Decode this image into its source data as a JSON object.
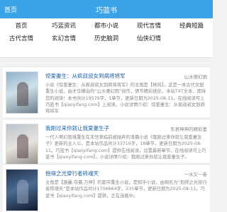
{
  "header": {
    "home_label": "首页",
    "title": "巧蓝书"
  },
  "nav": {
    "row1": [
      "首页",
      "巧蓝资讯",
      "都市小说",
      "现代言情",
      "经典短篇"
    ],
    "row2": [
      "古代言情",
      "玄幻言情",
      "历史脑洞",
      "仙侠幻情"
    ]
  },
  "books": [
    {
      "title": "惊爱妻生：从疯叔叔女到病将将军",
      "author": "山水傻幻雨",
      "desc": "小说《惊爱妻生：从疯叔叔女到病将将军》的主角是【林风】，这是一本古代女配重生小说，由才华横溢的“山水傻幻雨”创作，情节精彩绝伦。本站TXT全本，期待您的阅读！本书共计19579字，1章节，更新日期为2025-08-11。在线阅读可上巧蓝书【qiaoyifang.com】上阅读。小说详情介绍：惊爱妻生：从疯叔叔女到病将将军"
    },
    {
      "title": "我刚过来你就让我爱妻生子",
      "author": "东君神神的精彩里",
      "desc": "一代人啊幻般境重生在末世来临前被抛弃的清晨小说《我刚过来你就让我爱妻生子》更新的主人公，是本站作品共计33716字，18章节，更新日期为2025-08-11。巧蓝书【qiaoyifang.com】提供在线阅读，设置最新章节，在线阅读可上巧蓝书【qiaoyifang.com】，小说详情介绍：我刚过来你就让我爱妻生子。"
    },
    {
      "title": "抱得之光穿行者转魂天",
      "author": "一水又一卷",
      "desc": "主角是【路麗.夺晨.万梓】的都市重生小说，是知乎小说，由网名为“抱得之光穿行者转魂天”是本站作品共计1706664字，235章节，更新日期为2025-08-11。巧蓝书【qiaoyifang.com】提供，正在连载中。"
    }
  ]
}
